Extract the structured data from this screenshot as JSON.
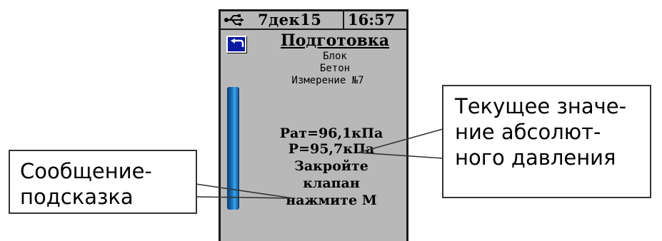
{
  "status_bar": {
    "date": "7дек15",
    "time": "16:57",
    "usb_icon": "usb-icon"
  },
  "screen": {
    "back_icon": "back-arrow-icon",
    "title": "Подготовка",
    "lines": [
      "Блок",
      "Бетон",
      "Измерение №7"
    ],
    "pat": "Pат=96,1кПа",
    "p": "P=95,7кПа",
    "prompt": [
      "Закройте",
      "клапан",
      "нажмите M"
    ]
  },
  "callouts": {
    "right": [
      "Текущее значе-",
      "ние абсолют-",
      "ного давления"
    ],
    "left": [
      "Сообщение-",
      "подсказка"
    ]
  },
  "colors": {
    "screen_bg": "#b8b8b8",
    "scrollbar": "#1c7ac6",
    "back_button": "#0a1aa0"
  }
}
